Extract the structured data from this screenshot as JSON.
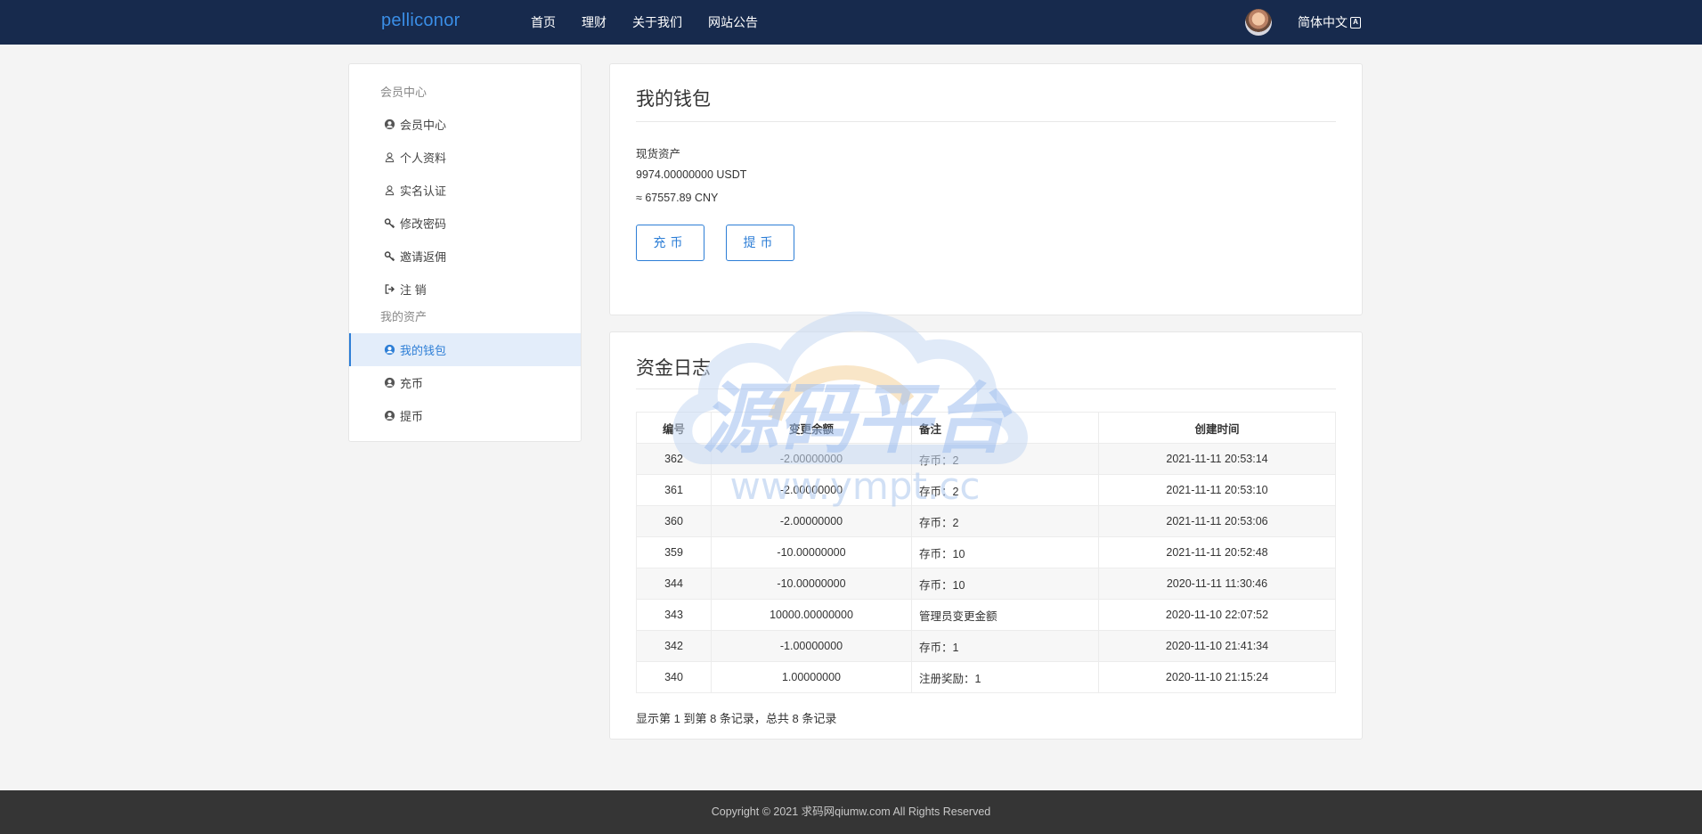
{
  "header": {
    "brand": "pelliconor",
    "nav": [
      "首页",
      "理财",
      "关于我们",
      "网站公告"
    ],
    "language": "简体中文",
    "language_icon": "translate-icon"
  },
  "sidebar": {
    "group1": "会员中心",
    "items1": [
      {
        "label": "会员中心",
        "icon": "user-circle-icon"
      },
      {
        "label": "个人资料",
        "icon": "user-outline-icon"
      },
      {
        "label": "实名认证",
        "icon": "user-outline-icon"
      },
      {
        "label": "修改密码",
        "icon": "key-icon"
      },
      {
        "label": "邀请返佣",
        "icon": "key-icon"
      },
      {
        "label": "注 销",
        "icon": "sign-out-icon"
      }
    ],
    "group2": "我的资产",
    "items2": [
      {
        "label": "我的钱包",
        "icon": "user-circle-icon",
        "active": true
      },
      {
        "label": "充币",
        "icon": "user-circle-icon"
      },
      {
        "label": "提币",
        "icon": "user-circle-icon"
      }
    ]
  },
  "wallet": {
    "title": "我的钱包",
    "asset_label": "现货资产",
    "balance": "9974.00000000 USDT",
    "cny": "≈ 67557.89 CNY",
    "deposit_button": "充币",
    "withdraw_button": "提币"
  },
  "ledger": {
    "title": "资金日志",
    "columns": [
      "编号",
      "变更余额",
      "备注",
      "创建时间"
    ],
    "rows": [
      [
        "362",
        "-2.00000000",
        "存币：2",
        "2021-11-11 20:53:14"
      ],
      [
        "361",
        "-2.00000000",
        "存币：2",
        "2021-11-11 20:53:10"
      ],
      [
        "360",
        "-2.00000000",
        "存币：2",
        "2021-11-11 20:53:06"
      ],
      [
        "359",
        "-10.00000000",
        "存币：10",
        "2021-11-11 20:52:48"
      ],
      [
        "344",
        "-10.00000000",
        "存币：10",
        "2020-11-11 11:30:46"
      ],
      [
        "343",
        "10000.00000000",
        "管理员变更金额",
        "2020-11-10 22:07:52"
      ],
      [
        "342",
        "-1.00000000",
        "存币：1",
        "2020-11-10 21:41:34"
      ],
      [
        "340",
        "1.00000000",
        "注册奖励：1",
        "2020-11-10 21:15:24"
      ]
    ],
    "summary": "显示第 1 到第 8 条记录，总共 8 条记录"
  },
  "watermark": {
    "text": "源码平台",
    "url": "www.ympt.cc"
  },
  "footer": {
    "copyright": "Copyright © 2021 求码网qiumw.com All Rights Reserved"
  },
  "colors": {
    "topbar": "#172a4d",
    "accent": "#2d7ed6",
    "footer": "#353535"
  }
}
